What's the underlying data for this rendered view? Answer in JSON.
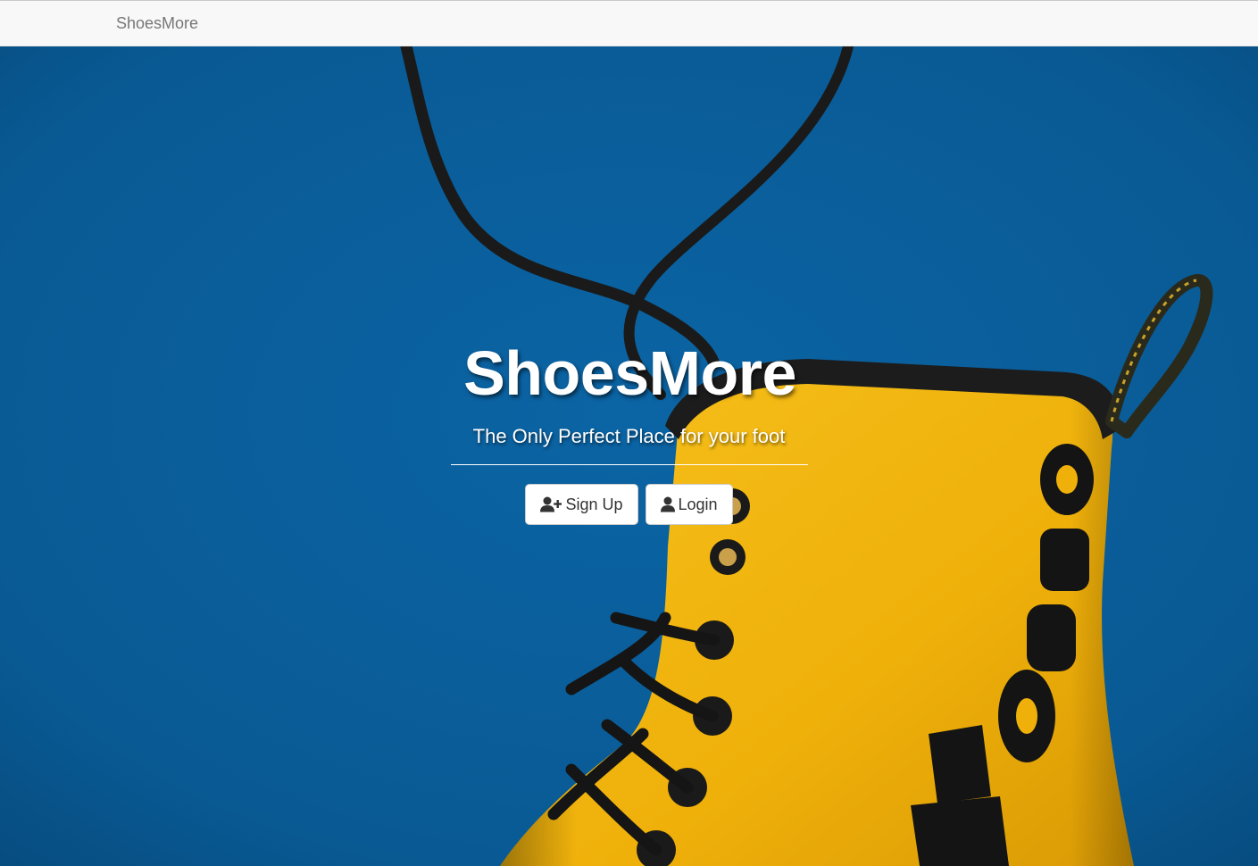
{
  "navbar": {
    "brand": "ShoesMore"
  },
  "hero": {
    "title": "ShoesMore",
    "subtitle": "The Only Perfect Place for your foot",
    "buttons": {
      "signup_label": "Sign Up",
      "signup_icon": "user-plus-icon",
      "login_label": "Login",
      "login_icon": "user-icon"
    },
    "background": {
      "description_colors": {
        "wall": "#0a5c98",
        "boot": "#f2b40c",
        "lace": "#1a1a1a"
      }
    }
  }
}
